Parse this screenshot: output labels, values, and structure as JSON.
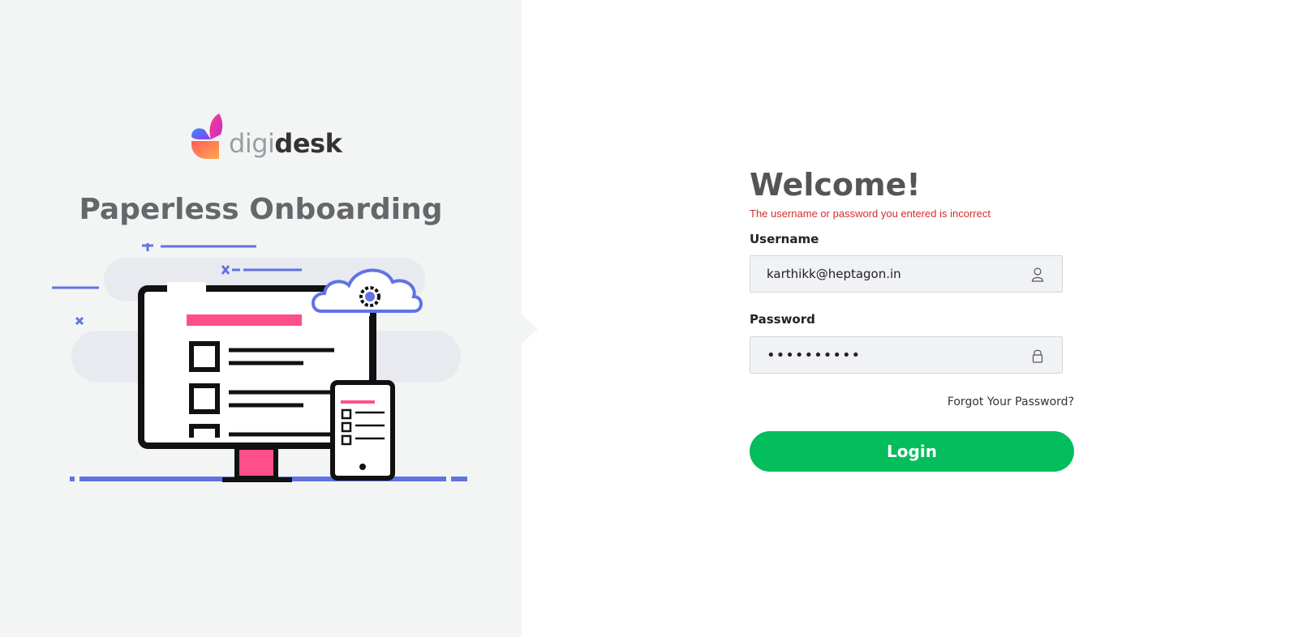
{
  "brand": {
    "name_light": "digi",
    "name_bold": "desk",
    "tagline": "Paperless Onboarding"
  },
  "login": {
    "heading": "Welcome!",
    "error": "The username or password you entered is incorrect",
    "username_label": "Username",
    "username_value": "karthikk@heptagon.in",
    "password_label": "Password",
    "password_value": "••••••••••",
    "forgot_link": "Forgot Your Password?",
    "login_button": "Login"
  },
  "colors": {
    "accent_green": "#04bd5d",
    "error_red": "#d0302c",
    "illustration_blue": "#5f73e3",
    "illustration_pink": "#ff4f8b"
  },
  "icons": {
    "username": "user-icon",
    "password": "lock-icon"
  }
}
